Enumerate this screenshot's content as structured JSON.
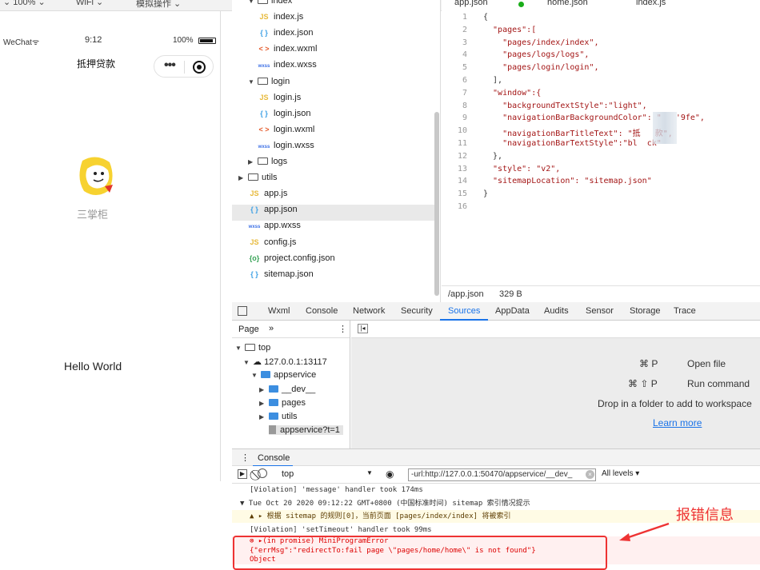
{
  "toolbar": {
    "zoom": "100%",
    "network": "WiFi",
    "mode": "模拟操作"
  },
  "simulator": {
    "carrier": "WeChat",
    "time": "9:12",
    "battery": "100%",
    "nav_title": "抵押贷款",
    "app_name": "三掌柜",
    "hello": "Hello World"
  },
  "filetree": {
    "items": [
      {
        "name": "index",
        "kind": "folder-open",
        "indent": 1
      },
      {
        "name": "index.js",
        "kind": "js",
        "indent": 2
      },
      {
        "name": "index.json",
        "kind": "json",
        "indent": 2
      },
      {
        "name": "index.wxml",
        "kind": "wxml",
        "indent": 2
      },
      {
        "name": "index.wxss",
        "kind": "wxss",
        "indent": 2
      },
      {
        "name": "login",
        "kind": "folder-open",
        "indent": 1
      },
      {
        "name": "login.js",
        "kind": "js",
        "indent": 2
      },
      {
        "name": "login.json",
        "kind": "json",
        "indent": 2
      },
      {
        "name": "login.wxml",
        "kind": "wxml",
        "indent": 2
      },
      {
        "name": "login.wxss",
        "kind": "wxss",
        "indent": 2
      },
      {
        "name": "logs",
        "kind": "folder",
        "indent": 1
      },
      {
        "name": "utils",
        "kind": "folder",
        "indent": 0
      },
      {
        "name": "app.js",
        "kind": "js",
        "indent": 1
      },
      {
        "name": "app.json",
        "kind": "json",
        "indent": 1,
        "selected": true
      },
      {
        "name": "app.wxss",
        "kind": "wxss",
        "indent": 1
      },
      {
        "name": "config.js",
        "kind": "js",
        "indent": 1
      },
      {
        "name": "project.config.json",
        "kind": "cfg",
        "indent": 1
      },
      {
        "name": "sitemap.json",
        "kind": "json",
        "indent": 1
      }
    ]
  },
  "editor": {
    "tabs": [
      "app.json",
      "home.json",
      "index.js"
    ],
    "lines": [
      "{",
      "  \"pages\":[",
      "    \"pages/index/index\",",
      "    \"pages/logs/logs\",",
      "    \"pages/login/login\",",
      "  ],",
      "  \"window\":{",
      "    \"backgroundTextStyle\":\"light\",",
      "    \"navigationBarBackgroundColor\": \"   '9fe\",",
      "    \"navigationBarTitleText\": \"抵   款\",",
      "    \"navigationBarTextStyle\":\"bl  ck\"",
      "  },",
      "  \"style\": \"v2\",",
      "  \"sitemapLocation\": \"sitemap.json\"",
      "}",
      ""
    ],
    "status_file": "/app.json",
    "status_size": "329 B"
  },
  "devtools": {
    "tabs": [
      "Wxml",
      "Console",
      "Network",
      "Security",
      "Sources",
      "AppData",
      "Audits",
      "Sensor",
      "Storage",
      "Trace"
    ],
    "active_tab": "Sources",
    "page_tab": "Page",
    "more": "»",
    "tree": [
      "top",
      "127.0.0.1:13117",
      "appservice",
      "__dev__",
      "pages",
      "utils",
      "appservice?t=1"
    ],
    "shortcuts": [
      {
        "keys": "⌘ P",
        "action": "Open file"
      },
      {
        "keys": "⌘ ⇧ P",
        "action": "Run command"
      }
    ],
    "drop_hint": "Drop in a folder to add to workspace",
    "learn_more": "Learn more",
    "console_tab": "Console",
    "context": "top",
    "filter": "-url:http://127.0.0.1:50470/appservice/__dev_",
    "levels": "All levels ▾",
    "logs": [
      {
        "type": "info",
        "text": "[Violation] 'message' handler took 174ms"
      },
      {
        "type": "group",
        "text": "▼ Tue Oct 20 2020 09:12:22 GMT+0800 (中国标准时间) sitemap 索引情况提示"
      },
      {
        "type": "warn",
        "text": "▲ ▸ 根据 sitemap 的规则[0]，当前页面 [pages/index/index] 将被索引"
      },
      {
        "type": "info",
        "text": "[Violation] 'setTimeout' handler took 99ms"
      },
      {
        "type": "err",
        "text": "⊗ ▸(in promise) MiniProgramError"
      },
      {
        "type": "err",
        "text": "{\"errMsg\":\"redirectTo:fail page \\\"pages/home/home\\\" is not found\"}"
      },
      {
        "type": "err",
        "text": "Object"
      }
    ]
  },
  "annotation": {
    "label": "报错信息",
    "color": "#e33333"
  }
}
